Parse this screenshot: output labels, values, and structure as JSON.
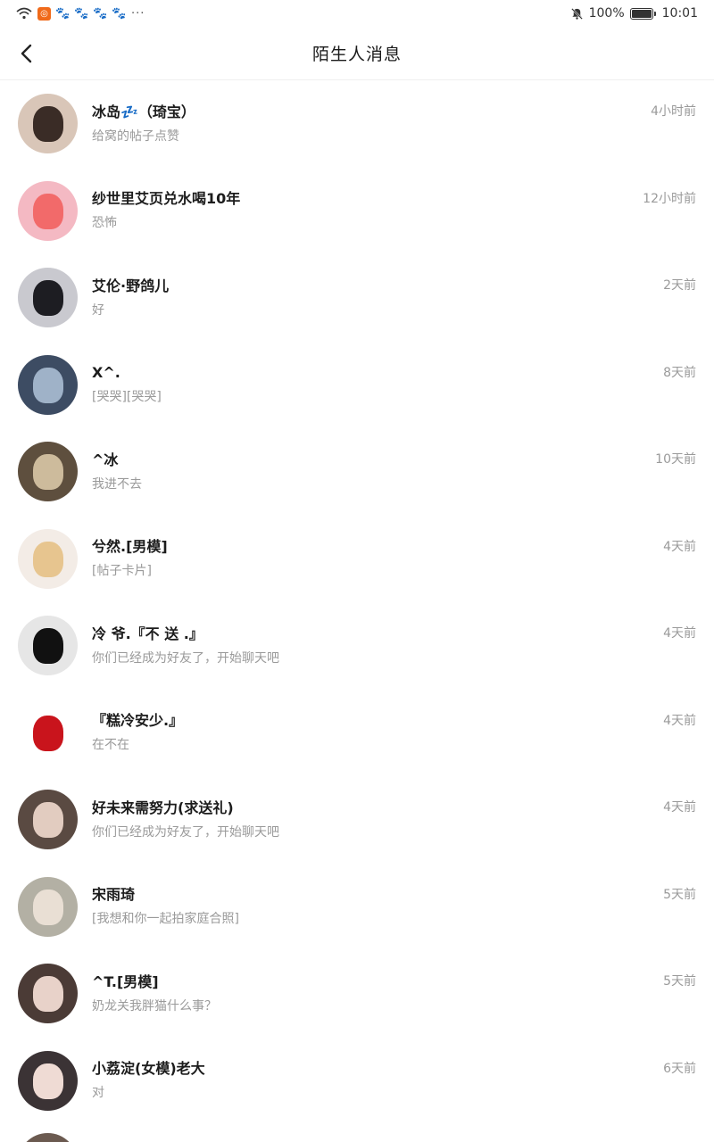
{
  "status_bar": {
    "battery_text": "100%",
    "time": "10:01",
    "icons": [
      "wifi-icon",
      "orange-app-icon",
      "paw-icon",
      "paw-icon",
      "paw-icon",
      "paw-icon",
      "more-dots-icon"
    ],
    "more": "···"
  },
  "header": {
    "title": "陌生人消息",
    "back_icon": "chevron-left-icon"
  },
  "conversations": [
    {
      "name": "冰岛💤（琦宝）",
      "preview": "给窝的帖子点赞",
      "time": "4小时前",
      "avatar_color": "#d9c6b8",
      "face_color": "#3a2c26"
    },
    {
      "name": "纱世里艾页兑水喝10年",
      "preview": "恐怖",
      "time": "12小时前",
      "avatar_color": "#f4b9c3",
      "face_color": "#f26a6a"
    },
    {
      "name": "艾伦·野鸽儿",
      "preview": "好",
      "time": "2天前",
      "avatar_color": "#c9c9cf",
      "face_color": "#1d1d22"
    },
    {
      "name": "X^.",
      "preview": "[哭哭][哭哭]",
      "time": "8天前",
      "avatar_color": "#3d4c63",
      "face_color": "#9fb2c8"
    },
    {
      "name": "^冰",
      "preview": "我进不去",
      "time": "10天前",
      "avatar_color": "#5e4f3e",
      "face_color": "#cdbb9c"
    },
    {
      "name": "兮然.[男模]",
      "preview": "[帖子卡片]",
      "time": "4天前",
      "avatar_color": "#f3ece6",
      "face_color": "#e7c58f"
    },
    {
      "name": "冷 爷.『不 送 .』",
      "preview": "你们已经成为好友了，开始聊天吧",
      "time": "4天前",
      "avatar_color": "#e6e6e6",
      "face_color": "#111111"
    },
    {
      "name": "『糕冷安少.』",
      "preview": "在不在",
      "time": "4天前",
      "avatar_color": "#ffffff",
      "face_color": "#c9141c"
    },
    {
      "name": "好未来需努力(求送礼)",
      "preview": "你们已经成为好友了，开始聊天吧",
      "time": "4天前",
      "avatar_color": "#5a4a42",
      "face_color": "#e2ccc0"
    },
    {
      "name": "宋雨琦",
      "preview": "[我想和你一起拍家庭合照]",
      "time": "5天前",
      "avatar_color": "#b3b0a4",
      "face_color": "#e9dfd4"
    },
    {
      "name": "^T.[男模]",
      "preview": "奶龙关我胖猫什么事？",
      "time": "5天前",
      "avatar_color": "#4b3b36",
      "face_color": "#e8d2c9"
    },
    {
      "name": "小荔淀(女模)老大",
      "preview": "对",
      "time": "6天前",
      "avatar_color": "#3b3335",
      "face_color": "#efdbd4"
    }
  ]
}
